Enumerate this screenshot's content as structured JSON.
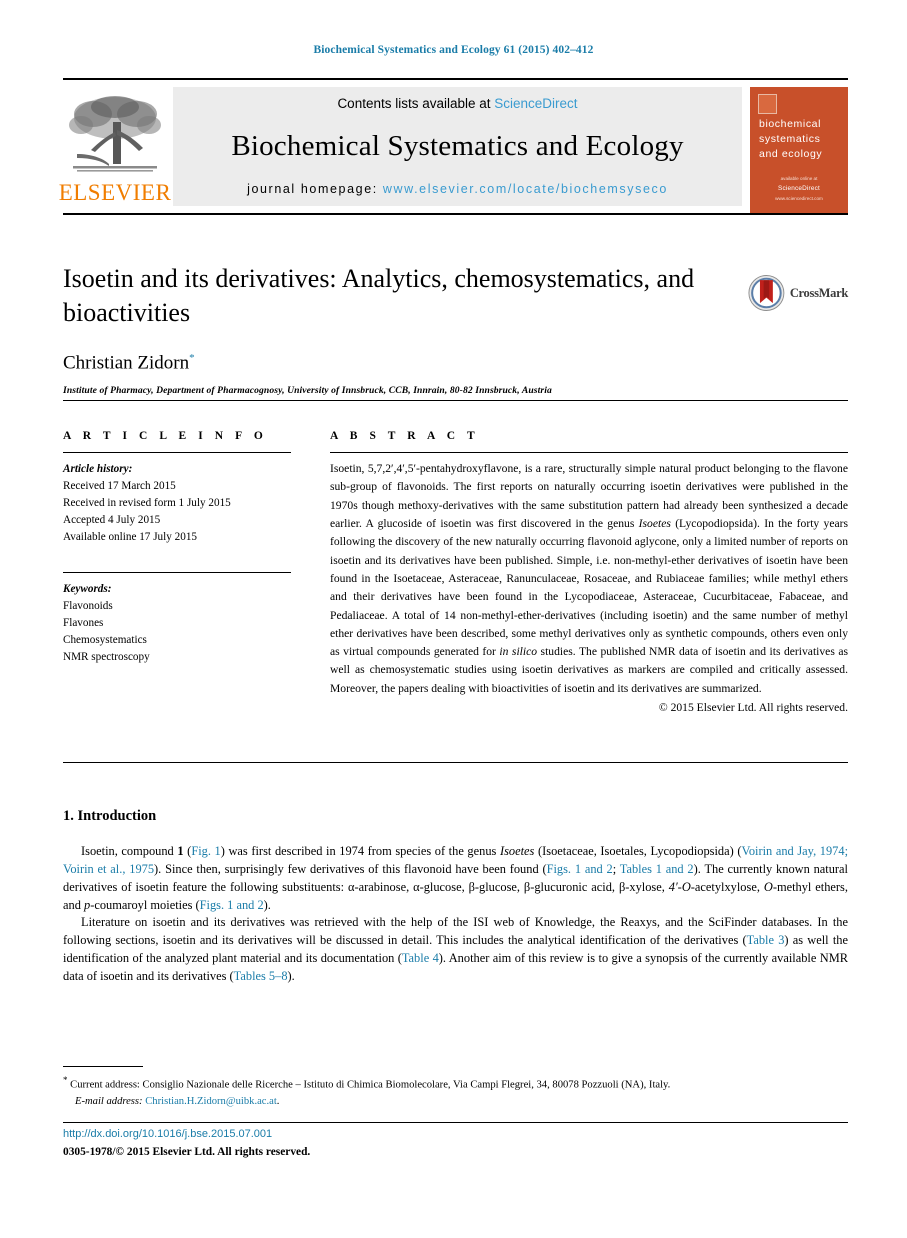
{
  "running_head": "Biochemical Systematics and Ecology 61 (2015) 402–412",
  "masthead": {
    "publisher_name": "ELSEVIER",
    "contents_prefix": "Contents lists available at ",
    "contents_link": "ScienceDirect",
    "journal_title": "Biochemical Systematics and Ecology",
    "homepage_prefix": "journal homepage: ",
    "homepage_url": "www.elsevier.com/locate/biochemsyseco",
    "cover": {
      "title_line1": "biochemical",
      "title_line2": "systematics",
      "title_line3": "and ecology",
      "foot_small": "available online at",
      "foot_brand": "ScienceDirect",
      "foot_url": "www.sciencedirect.com"
    }
  },
  "article": {
    "title": "Isoetin and its derivatives: Analytics, chemosystematics, and bioactivities",
    "author": "Christian Zidorn",
    "author_marker": "*",
    "affiliation": "Institute of Pharmacy, Department of Pharmacognosy, University of Innsbruck, CCB, Innrain, 80-82 Innsbruck, Austria",
    "crossmark_label": "CrossMark"
  },
  "info": {
    "heading": "A R T I C L E   I N F O",
    "history_label": "Article history:",
    "history": [
      "Received 17 March 2015",
      "Received in revised form 1 July 2015",
      "Accepted 4 July 2015",
      "Available online 17 July 2015"
    ],
    "keywords_label": "Keywords:",
    "keywords": [
      "Flavonoids",
      "Flavones",
      "Chemosystematics",
      "NMR spectroscopy"
    ]
  },
  "abstract": {
    "heading": "A B S T R A C T",
    "text_part1": "Isoetin, 5,7,2′,4′,5′-pentahydroxyflavone, is a rare, structurally simple natural product belonging to the flavone sub-group of flavonoids. The first reports on naturally occurring isoetin derivatives were published in the 1970s though methoxy-derivatives with the same substitution pattern had already been synthesized a decade earlier. A glucoside of isoetin was first discovered in the genus ",
    "genus_italic": "Isoetes",
    "text_part2": " (Lycopodiopsida). In the forty years following the discovery of the new naturally occurring flavonoid aglycone, only a limited number of reports on isoetin and its derivatives have been published. Simple, i.e. non-methyl-ether derivatives of isoetin have been found in the Isoetaceae, Asteraceae, Ranunculaceae, Rosaceae, and Rubiaceae families; while methyl ethers and their derivatives have been found in the Lycopodiaceae, Asteraceae, Cucurbitaceae, Fabaceae, and Pedaliaceae. A total of 14 non-methyl-ether-derivatives (including isoetin) and the same number of methyl ether derivatives have been described, some methyl derivatives only as synthetic compounds, others even only as virtual compounds generated for ",
    "insilico_italic": "in silico",
    "text_part3": " studies. The published NMR data of isoetin and its derivatives as well as chemosystematic studies using isoetin derivatives as markers are compiled and critically assessed. Moreover, the papers dealing with bioactivities of isoetin and its derivatives are summarized.",
    "copyright": "© 2015 Elsevier Ltd. All rights reserved."
  },
  "introduction": {
    "heading": "1. Introduction",
    "p1_a": "Isoetin, compound ",
    "p1_bold1": "1",
    "p1_b": " (",
    "p1_ref1": "Fig. 1",
    "p1_c": ") was first described in 1974 from species of the genus ",
    "p1_italic1": "Isoetes",
    "p1_d": " (Isoetaceae, Isoetales, Lycopodiopsida) (",
    "p1_ref2": "Voirin and Jay, 1974; Voirin et al., 1975",
    "p1_e": "). Since then, surprisingly few derivatives of this flavonoid have been found (",
    "p1_ref3": "Figs. 1 and 2",
    "p1_f": "; ",
    "p1_ref4": "Tables 1 and 2",
    "p1_g": "). The currently known natural derivatives of isoetin feature the following substituents: α-arabinose, α-glucose, β-glucose, β-glucuronic acid, β-xylose, ",
    "p1_italic2": "4′-O",
    "p1_h": "-acetylxylose, ",
    "p1_italic3": "O",
    "p1_i": "-methyl ethers, and ",
    "p1_italic4": "p",
    "p1_j": "-coumaroyl moieties (",
    "p1_ref5": "Figs. 1 and 2",
    "p1_k": ").",
    "p2_a": "Literature on isoetin and its derivatives was retrieved with the help of the ISI web of Knowledge, the Reaxys, and the SciFinder databases. In the following sections, isoetin and its derivatives will be discussed in detail. This includes the analytical identification of the derivatives (",
    "p2_ref1": "Table 3",
    "p2_b": ") as well the identification of the analyzed plant material and its documentation (",
    "p2_ref2": "Table 4",
    "p2_c": "). Another aim of this review is to give a synopsis of the currently available NMR data of isoetin and its derivatives (",
    "p2_ref3": "Tables 5–8",
    "p2_d": ")."
  },
  "footer": {
    "marker": "*",
    "current_address": "Current address: Consiglio Nazionale delle Ricerche – Istituto di Chimica Biomolecolare, Via Campi Flegrei, 34, 80078 Pozzuoli (NA), Italy.",
    "email_label": "E-mail address:",
    "email": "Christian.H.Zidorn@uibk.ac.at",
    "email_suffix": ".",
    "doi": "http://dx.doi.org/10.1016/j.bse.2015.07.001",
    "issn_copyright": "0305-1978/© 2015 Elsevier Ltd. All rights reserved."
  },
  "colors": {
    "link_blue": "#1a7ca8",
    "sciencedirect_blue": "#3a9bd0",
    "elsevier_orange": "#f07d00",
    "cover_orange": "#c8502a",
    "band_gray": "#ececec"
  }
}
